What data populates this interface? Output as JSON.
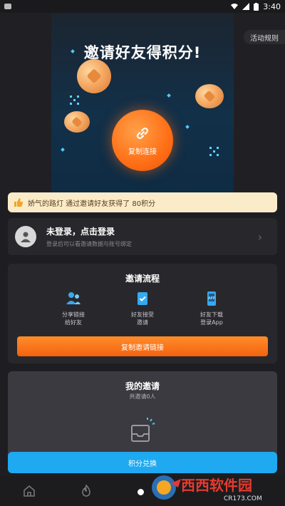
{
  "status_bar": {
    "time": "3:40"
  },
  "hero": {
    "title": "邀请好友得积分!",
    "rules_label": "活动规则",
    "copy_label": "复制连接"
  },
  "notice": {
    "text": "娇气的路灯 通过邀请好友获得了 80积分"
  },
  "login": {
    "title": "未登录，点击登录",
    "subtitle": "登录后可以看邀请数据与账号绑定"
  },
  "flow": {
    "title": "邀请流程",
    "steps": [
      {
        "label": "分享链接\n给好友",
        "icon": "users-icon"
      },
      {
        "label": "好友接受\n邀请",
        "icon": "accept-icon"
      },
      {
        "label": "好友下载\n登录App",
        "icon": "app-download-icon"
      }
    ],
    "button_label": "复制邀请链接"
  },
  "my_invites": {
    "title": "我的邀请",
    "count_text": "共邀请0人"
  },
  "exchange": {
    "button_label": "积分兑换"
  },
  "watermark": {
    "text": "西西软件园",
    "url_text": "CR173.COM"
  },
  "colors": {
    "accent_orange": "#ff6f16",
    "accent_blue": "#1ea9f0",
    "notice_bg": "#fbecc9"
  }
}
